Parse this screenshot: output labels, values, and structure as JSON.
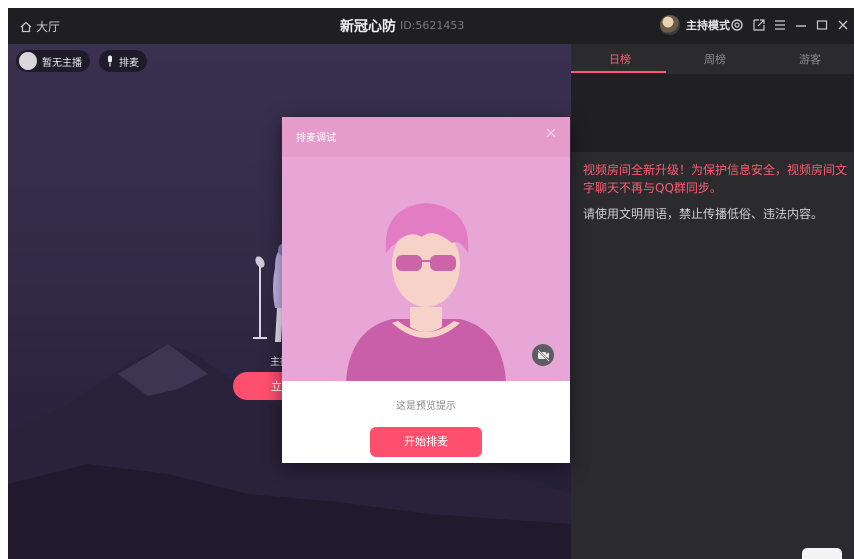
{
  "titlebar": {
    "hall_label": "大厅",
    "room_title": "新冠心防",
    "room_id": "ID:5621453",
    "host_mode_label": "主持模式"
  },
  "stage": {
    "host_chip_label": "暂无主播",
    "mic_chip_label": "排麦",
    "host_caption": "主持",
    "join_button_label": "立即"
  },
  "right_panel": {
    "tabs": [
      {
        "label": "日榜",
        "active": true
      },
      {
        "label": "周榜",
        "active": false
      },
      {
        "label": "游客",
        "active": false
      }
    ],
    "notice": "视频房间全新升级！为保护信息安全，视频房间文字聊天不再与QQ群同步。",
    "rule": "请使用文明用语，禁止传播低俗、违法内容。"
  },
  "dialog": {
    "title": "排麦调试",
    "tip": "这是预览提示",
    "start_button_label": "开始排麦"
  },
  "colors": {
    "accent": "#ff4f6e",
    "titlebar_bg": "#1f1f21",
    "panel_bg": "#2b2b2d",
    "preview_bg": "#e8a6d6"
  },
  "icons": [
    "home-icon",
    "settings-icon",
    "popout-icon",
    "menu-icon",
    "minimize-icon",
    "maximize-icon",
    "close-icon",
    "mic-icon",
    "camera-off-icon"
  ]
}
